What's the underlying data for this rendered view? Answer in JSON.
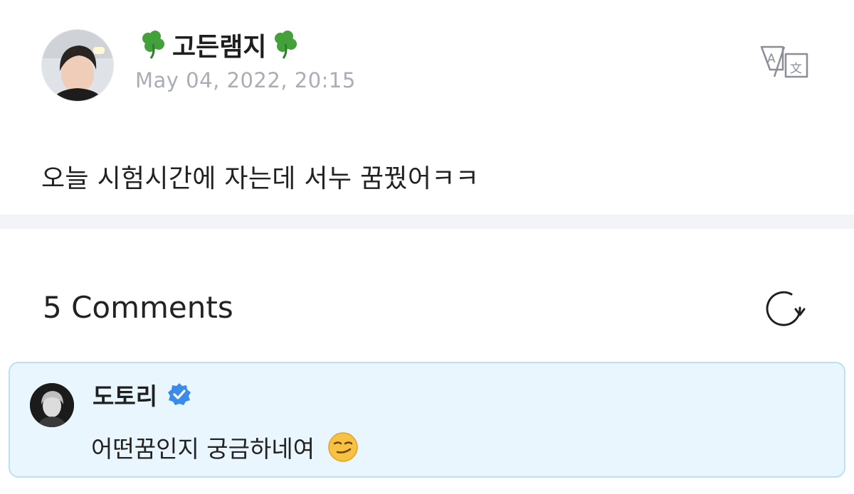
{
  "post": {
    "author": "고든램지",
    "timestamp": "May 04, 2022, 20:15",
    "body": "오늘 시험시간에 자는데 서누 꿈꿨어ㅋㅋ",
    "translate_icon": "translate-icon"
  },
  "comments": {
    "header": "5 Comments",
    "refresh_icon": "refresh-icon",
    "items": [
      {
        "author": "도토리",
        "text": "어떤꿈인지 궁금하네여",
        "verified": true
      }
    ]
  },
  "colors": {
    "timestamp": "#a9adb6",
    "divider": "#f3f4f7",
    "comment_bg": "#eaf6fe",
    "comment_border": "#b9e0f6",
    "verified": "#3b8beb",
    "clover": "#43a03b"
  }
}
